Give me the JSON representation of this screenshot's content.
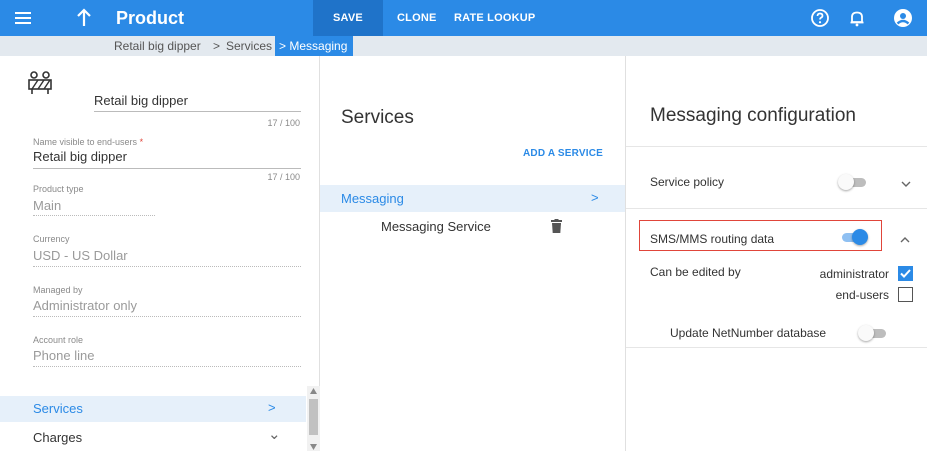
{
  "topbar": {
    "title": "Product",
    "save_label": "SAVE",
    "clone_label": "CLONE",
    "rate_lookup_label": "RATE LOOKUP",
    "icons": [
      "menu-icon",
      "arrow-up-icon",
      "help-icon",
      "bell-icon",
      "account-icon"
    ]
  },
  "breadcrumb": {
    "items": [
      "Retail big dipper",
      "Services",
      "Messaging"
    ],
    "separator": ">"
  },
  "product": {
    "name": "Retail big dipper",
    "name_counter": "17 / 100",
    "fields": [
      {
        "label": "Name visible to end-users",
        "required_mark": "*",
        "value": "Retail big dipper",
        "counter": "17 / 100"
      },
      {
        "label": "Product type",
        "value": "Main"
      },
      {
        "label": "Currency",
        "value": "USD - US Dollar"
      },
      {
        "label": "Managed by",
        "value": "Administrator only"
      },
      {
        "label": "Account role",
        "value": "Phone line"
      }
    ],
    "nav": [
      {
        "label": "Services",
        "chevron": ">"
      },
      {
        "label": "Charges",
        "chevron": "⌄"
      }
    ]
  },
  "services": {
    "title": "Services",
    "add_label": "ADD A SERVICE",
    "groups": [
      {
        "label": "Messaging",
        "chevron": ">",
        "items": [
          "Messaging Service"
        ]
      }
    ]
  },
  "config": {
    "title": "Messaging configuration",
    "service_policy": {
      "label": "Service policy",
      "enabled": false
    },
    "routing": {
      "label": "SMS/MMS routing data",
      "enabled": true,
      "can_be_edited_by": "Can be edited by",
      "editors": [
        {
          "label": "administrator",
          "checked": true
        },
        {
          "label": "end-users",
          "checked": false
        }
      ],
      "update_label": "Update NetNumber database",
      "update_enabled": false
    }
  },
  "colors": {
    "accent": "#2b8ae6",
    "highlight_border": "#e0453a",
    "selected_bg": "#e6f0fa"
  }
}
